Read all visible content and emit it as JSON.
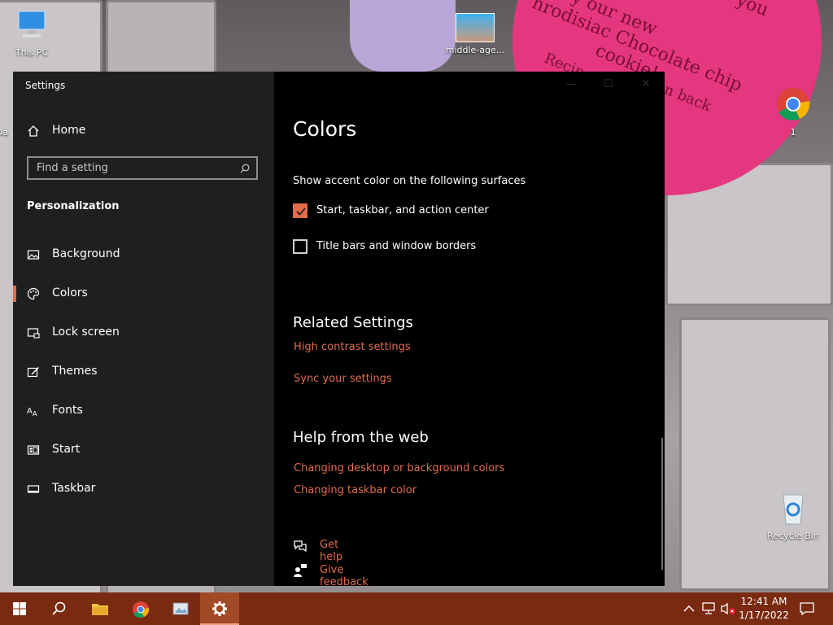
{
  "desktop": {
    "icons": [
      {
        "label": "This PC"
      },
      {
        "label": "middle-age..."
      },
      {
        "label": "1"
      },
      {
        "label": "Recycle Bin"
      },
      {
        "label": "Da"
      }
    ],
    "wallpaper_text": [
      "y our new",
      "hrodisiac Chocolate chip",
      "cookie!",
      "Recip",
      "n back",
      "you"
    ]
  },
  "window": {
    "title": "Settings",
    "controls": {
      "minimize": "—",
      "maximize": "☐",
      "close": "✕"
    }
  },
  "sidebar": {
    "home": "Home",
    "search_placeholder": "Find a setting",
    "section": "Personalization",
    "items": [
      {
        "label": "Background",
        "icon": "image-icon"
      },
      {
        "label": "Colors",
        "icon": "palette-icon",
        "active": true
      },
      {
        "label": "Lock screen",
        "icon": "lock-screen-icon"
      },
      {
        "label": "Themes",
        "icon": "themes-icon"
      },
      {
        "label": "Fonts",
        "icon": "fonts-icon"
      },
      {
        "label": "Start",
        "icon": "start-icon"
      },
      {
        "label": "Taskbar",
        "icon": "taskbar-icon"
      }
    ]
  },
  "content": {
    "title": "Colors",
    "accent_desc": "Show accent color on the following surfaces",
    "checks": [
      {
        "label": "Start, taskbar, and action center",
        "checked": true
      },
      {
        "label": "Title bars and window borders",
        "checked": false
      }
    ],
    "related_title": "Related Settings",
    "related_links": [
      "High contrast settings",
      "Sync your settings"
    ],
    "help_title": "Help from the web",
    "help_links": [
      "Changing desktop or background colors",
      "Changing taskbar color"
    ],
    "get_help": "Get help",
    "give_feedback": "Give feedback"
  },
  "taskbar": {
    "time": "12:41 AM",
    "date": "1/17/2022"
  },
  "colors": {
    "accent": "#e06c4a",
    "taskbar": "#7a2a10",
    "sidebar_bg": "#1f1f1f",
    "content_bg": "#000000"
  }
}
